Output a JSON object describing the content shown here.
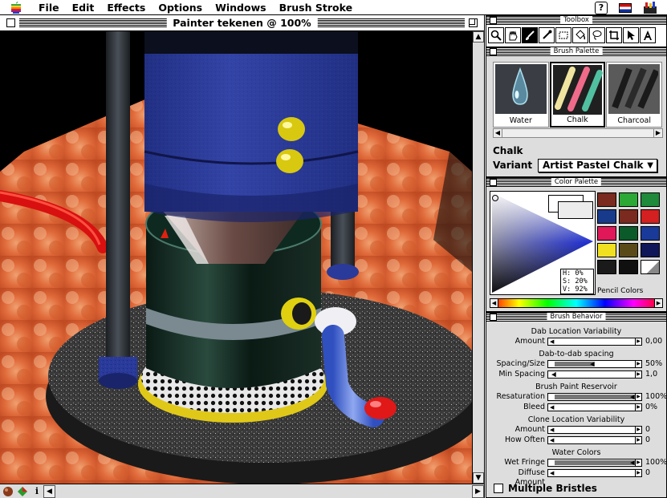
{
  "menubar": {
    "items": [
      "File",
      "Edit",
      "Effects",
      "Options",
      "Windows",
      "Brush Stroke"
    ]
  },
  "document": {
    "title": "Painter tekenen @ 100%"
  },
  "toolbox": {
    "title": "Toolbox",
    "tools": [
      "magnifier",
      "grabber",
      "brush",
      "dropper",
      "rectangle-select",
      "paint-bucket",
      "lasso",
      "crop",
      "arrow",
      "text"
    ]
  },
  "brush_palette": {
    "title": "Brush Palette",
    "brushes": [
      {
        "label": "Water",
        "selected": false
      },
      {
        "label": "Chalk",
        "selected": true
      },
      {
        "label": "Charcoal",
        "selected": false
      }
    ],
    "category": "Chalk",
    "variant_label": "Variant",
    "variant_value": "Artist Pastel Chalk"
  },
  "color_palette": {
    "title": "Color Palette",
    "hsv": {
      "h": "H:  0%",
      "s": "S: 20%",
      "v": "V: 92%"
    },
    "swatches": [
      "#7a2a1e",
      "#2ca836",
      "#1e8a3a",
      "#183a8a",
      "#7a2a1e",
      "#d42020",
      "#e0185a",
      "#0a5a2a",
      "#1a3a9a",
      "#f0e020",
      "#5a4a1a",
      "#10185a",
      "#1a1a1a",
      "#101010",
      "#ffffff"
    ],
    "swatch_set_label": "Pencil Colors"
  },
  "brush_behavior": {
    "title": "Brush Behavior",
    "groups": [
      {
        "title": "Dab Location Variability",
        "sliders": [
          {
            "label": "Amount",
            "value": "0,00",
            "level": 0
          }
        ]
      },
      {
        "title": "Dab-to-dab spacing",
        "sliders": [
          {
            "label": "Spacing/Size",
            "value": "50%",
            "level": 0.5
          },
          {
            "label": "Min Spacing",
            "value": "1,0",
            "level": 0.02
          }
        ]
      },
      {
        "title": "Brush Paint Reservoir",
        "sliders": [
          {
            "label": "Resaturation",
            "value": "100%",
            "level": 1
          },
          {
            "label": "Bleed",
            "value": "0%",
            "level": 0
          }
        ]
      },
      {
        "title": "Clone Location Variability",
        "sliders": [
          {
            "label": "Amount",
            "value": "0",
            "level": 0
          },
          {
            "label": "How Often",
            "value": "0",
            "level": 0
          }
        ]
      },
      {
        "title": "Water Colors",
        "sliders": [
          {
            "label": "Wet Fringe",
            "value": "100%",
            "level": 1
          },
          {
            "label": "Diffuse Amount",
            "value": "0",
            "level": 0
          }
        ]
      }
    ],
    "multiple_bristles_label": "Multiple Bristles",
    "multiple_bristles_checked": false
  }
}
